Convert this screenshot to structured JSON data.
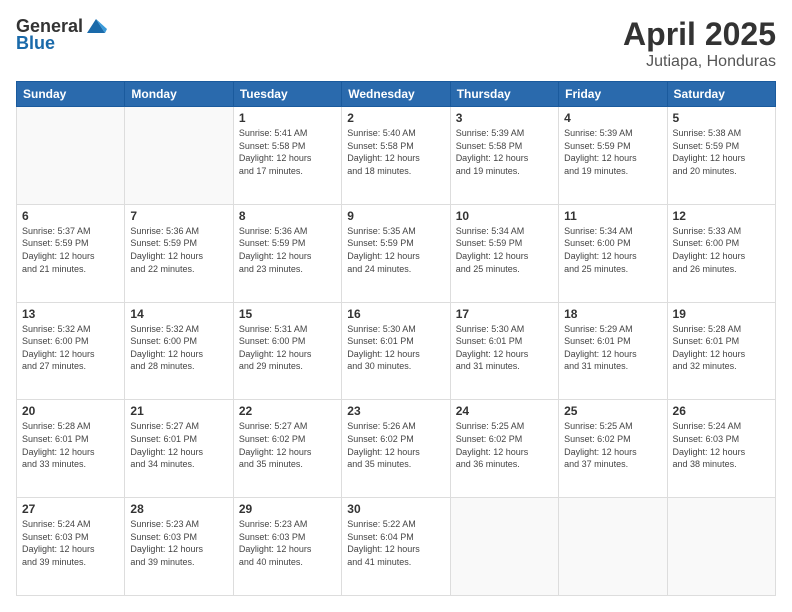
{
  "header": {
    "logo_general": "General",
    "logo_blue": "Blue",
    "title": "April 2025",
    "subtitle": "Jutiapa, Honduras"
  },
  "weekdays": [
    "Sunday",
    "Monday",
    "Tuesday",
    "Wednesday",
    "Thursday",
    "Friday",
    "Saturday"
  ],
  "weeks": [
    [
      {
        "day": "",
        "info": ""
      },
      {
        "day": "",
        "info": ""
      },
      {
        "day": "1",
        "info": "Sunrise: 5:41 AM\nSunset: 5:58 PM\nDaylight: 12 hours\nand 17 minutes."
      },
      {
        "day": "2",
        "info": "Sunrise: 5:40 AM\nSunset: 5:58 PM\nDaylight: 12 hours\nand 18 minutes."
      },
      {
        "day": "3",
        "info": "Sunrise: 5:39 AM\nSunset: 5:58 PM\nDaylight: 12 hours\nand 19 minutes."
      },
      {
        "day": "4",
        "info": "Sunrise: 5:39 AM\nSunset: 5:59 PM\nDaylight: 12 hours\nand 19 minutes."
      },
      {
        "day": "5",
        "info": "Sunrise: 5:38 AM\nSunset: 5:59 PM\nDaylight: 12 hours\nand 20 minutes."
      }
    ],
    [
      {
        "day": "6",
        "info": "Sunrise: 5:37 AM\nSunset: 5:59 PM\nDaylight: 12 hours\nand 21 minutes."
      },
      {
        "day": "7",
        "info": "Sunrise: 5:36 AM\nSunset: 5:59 PM\nDaylight: 12 hours\nand 22 minutes."
      },
      {
        "day": "8",
        "info": "Sunrise: 5:36 AM\nSunset: 5:59 PM\nDaylight: 12 hours\nand 23 minutes."
      },
      {
        "day": "9",
        "info": "Sunrise: 5:35 AM\nSunset: 5:59 PM\nDaylight: 12 hours\nand 24 minutes."
      },
      {
        "day": "10",
        "info": "Sunrise: 5:34 AM\nSunset: 5:59 PM\nDaylight: 12 hours\nand 25 minutes."
      },
      {
        "day": "11",
        "info": "Sunrise: 5:34 AM\nSunset: 6:00 PM\nDaylight: 12 hours\nand 25 minutes."
      },
      {
        "day": "12",
        "info": "Sunrise: 5:33 AM\nSunset: 6:00 PM\nDaylight: 12 hours\nand 26 minutes."
      }
    ],
    [
      {
        "day": "13",
        "info": "Sunrise: 5:32 AM\nSunset: 6:00 PM\nDaylight: 12 hours\nand 27 minutes."
      },
      {
        "day": "14",
        "info": "Sunrise: 5:32 AM\nSunset: 6:00 PM\nDaylight: 12 hours\nand 28 minutes."
      },
      {
        "day": "15",
        "info": "Sunrise: 5:31 AM\nSunset: 6:00 PM\nDaylight: 12 hours\nand 29 minutes."
      },
      {
        "day": "16",
        "info": "Sunrise: 5:30 AM\nSunset: 6:01 PM\nDaylight: 12 hours\nand 30 minutes."
      },
      {
        "day": "17",
        "info": "Sunrise: 5:30 AM\nSunset: 6:01 PM\nDaylight: 12 hours\nand 31 minutes."
      },
      {
        "day": "18",
        "info": "Sunrise: 5:29 AM\nSunset: 6:01 PM\nDaylight: 12 hours\nand 31 minutes."
      },
      {
        "day": "19",
        "info": "Sunrise: 5:28 AM\nSunset: 6:01 PM\nDaylight: 12 hours\nand 32 minutes."
      }
    ],
    [
      {
        "day": "20",
        "info": "Sunrise: 5:28 AM\nSunset: 6:01 PM\nDaylight: 12 hours\nand 33 minutes."
      },
      {
        "day": "21",
        "info": "Sunrise: 5:27 AM\nSunset: 6:01 PM\nDaylight: 12 hours\nand 34 minutes."
      },
      {
        "day": "22",
        "info": "Sunrise: 5:27 AM\nSunset: 6:02 PM\nDaylight: 12 hours\nand 35 minutes."
      },
      {
        "day": "23",
        "info": "Sunrise: 5:26 AM\nSunset: 6:02 PM\nDaylight: 12 hours\nand 35 minutes."
      },
      {
        "day": "24",
        "info": "Sunrise: 5:25 AM\nSunset: 6:02 PM\nDaylight: 12 hours\nand 36 minutes."
      },
      {
        "day": "25",
        "info": "Sunrise: 5:25 AM\nSunset: 6:02 PM\nDaylight: 12 hours\nand 37 minutes."
      },
      {
        "day": "26",
        "info": "Sunrise: 5:24 AM\nSunset: 6:03 PM\nDaylight: 12 hours\nand 38 minutes."
      }
    ],
    [
      {
        "day": "27",
        "info": "Sunrise: 5:24 AM\nSunset: 6:03 PM\nDaylight: 12 hours\nand 39 minutes."
      },
      {
        "day": "28",
        "info": "Sunrise: 5:23 AM\nSunset: 6:03 PM\nDaylight: 12 hours\nand 39 minutes."
      },
      {
        "day": "29",
        "info": "Sunrise: 5:23 AM\nSunset: 6:03 PM\nDaylight: 12 hours\nand 40 minutes."
      },
      {
        "day": "30",
        "info": "Sunrise: 5:22 AM\nSunset: 6:04 PM\nDaylight: 12 hours\nand 41 minutes."
      },
      {
        "day": "",
        "info": ""
      },
      {
        "day": "",
        "info": ""
      },
      {
        "day": "",
        "info": ""
      }
    ]
  ]
}
